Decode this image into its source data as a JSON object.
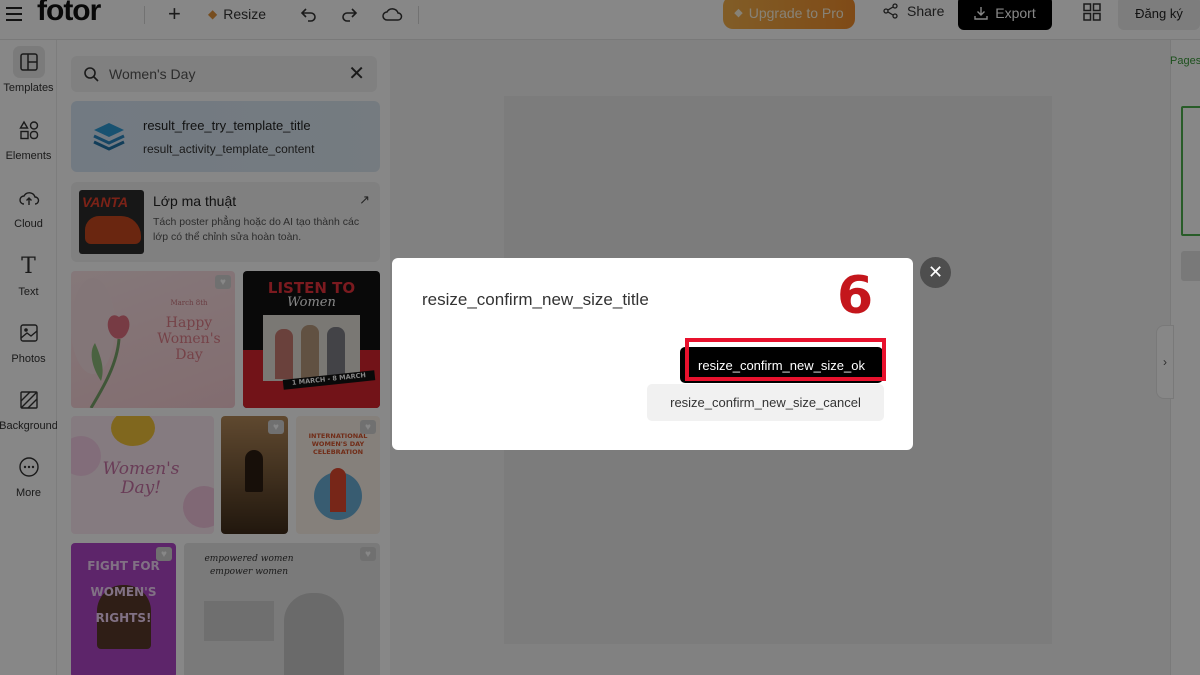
{
  "header": {
    "logo": "fotor",
    "resize_label": "Resize",
    "upgrade_label": "Upgrade to Pro",
    "share_label": "Share",
    "export_label": "Export",
    "signup_label": "Đăng ký"
  },
  "rail": {
    "items": [
      {
        "label": "Templates",
        "icon": "templates-icon"
      },
      {
        "label": "Elements",
        "icon": "elements-icon"
      },
      {
        "label": "Cloud",
        "icon": "cloud-upload-icon"
      },
      {
        "label": "Text",
        "icon": "text-icon"
      },
      {
        "label": "Photos",
        "icon": "photos-icon"
      },
      {
        "label": "Background",
        "icon": "background-icon"
      },
      {
        "label": "More",
        "icon": "more-icon"
      }
    ]
  },
  "panel": {
    "search_value": "Women's Day",
    "promo": {
      "title": "result_free_try_template_title",
      "content": "result_activity_template_content"
    },
    "layer_card": {
      "title": "Lớp ma thuật",
      "desc": "Tách poster phẳng hoặc do AI tạo thành các lớp có thể chỉnh sửa hoàn toàn.",
      "thumb_text": "VANTA"
    },
    "templates": {
      "t1": {
        "small": "March 8th",
        "main": "Happy Women's Day"
      },
      "t2": {
        "main": "LISTEN TO",
        "sub": "Women",
        "date": "1 MARCH - 8 MARCH"
      },
      "t3": {
        "main": "Women's Day!"
      },
      "t5": {
        "main": "INTERNATIONAL WOMEN'S DAY CELEBRATION"
      },
      "t6": {
        "main": "FIGHT FOR WOMEN'S RIGHTS!"
      },
      "t7": {
        "main": "empowered women empower women"
      }
    }
  },
  "right": {
    "pages_label": "Pages"
  },
  "modal": {
    "title": "resize_confirm_new_size_title",
    "ok_label": "resize_confirm_new_size_ok",
    "cancel_label": "resize_confirm_new_size_cancel",
    "step_number": "6"
  },
  "colors": {
    "accent_upgrade": "#f08d2c",
    "highlight_frame": "#e8112d",
    "step_number": "#c4161c",
    "pages_green": "#4cae4c"
  }
}
